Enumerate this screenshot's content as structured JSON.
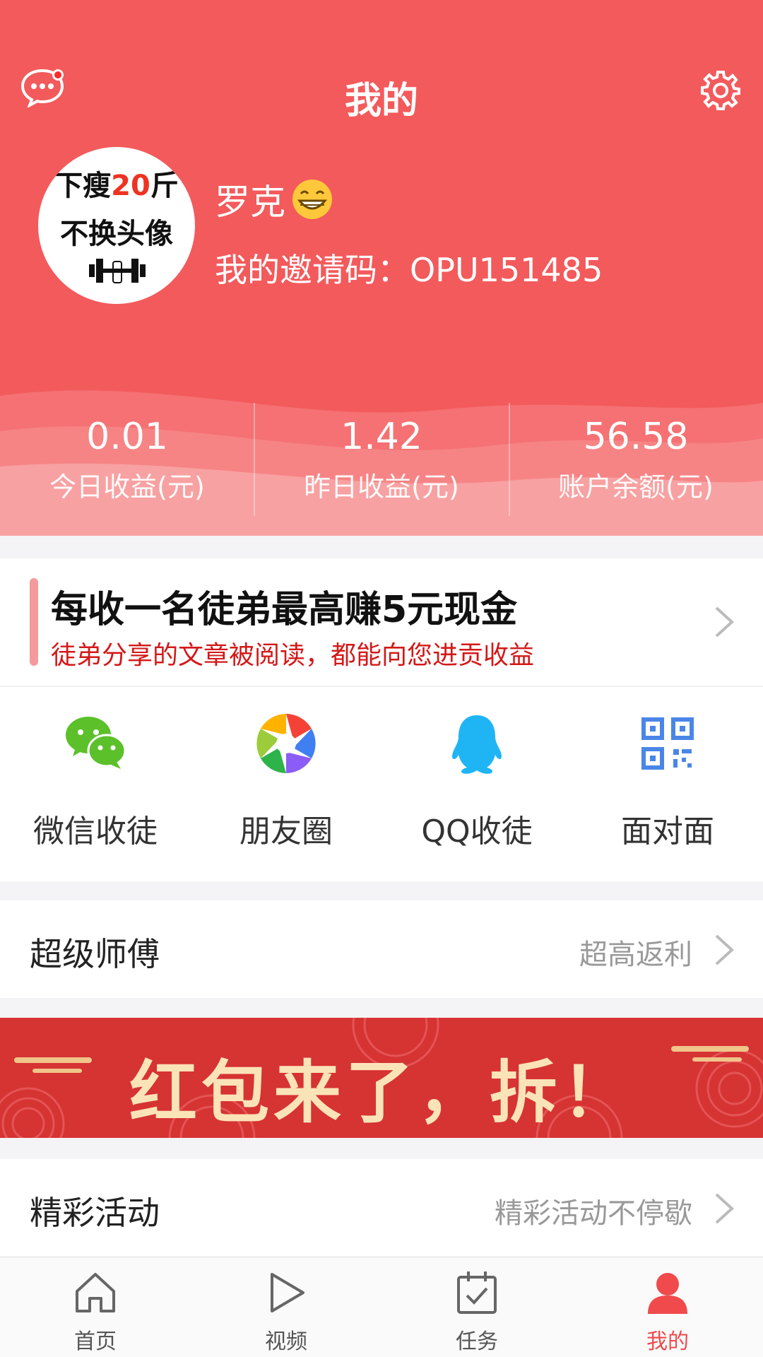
{
  "header": {
    "title": "我的",
    "username": "罗克",
    "invite_label": "我的邀请码：",
    "invite_code": "OPU151485",
    "avatar_text": {
      "line1_a": "下瘦",
      "line1_b": "20",
      "line1_c": "斤",
      "line2": "不换头像"
    }
  },
  "stats": [
    {
      "value": "0.01",
      "label": "今日收益(元)"
    },
    {
      "value": "1.42",
      "label": "昨日收益(元)"
    },
    {
      "value": "56.58",
      "label": "账户余额(元)"
    }
  ],
  "promo": {
    "headline": "每收一名徒弟最高赚5元现金",
    "subline": "徒弟分享的文章被阅读，都能向您进贡收益"
  },
  "share": [
    {
      "label": "微信收徒",
      "icon": "wechat-icon"
    },
    {
      "label": "朋友圈",
      "icon": "moments-icon"
    },
    {
      "label": "QQ收徒",
      "icon": "qq-icon"
    },
    {
      "label": "面对面",
      "icon": "qrcode-icon"
    }
  ],
  "rows": {
    "master": {
      "title": "超级师傅",
      "hint": "超高返利"
    },
    "events": {
      "title": "精彩活动",
      "hint": "精彩活动不停歇"
    }
  },
  "banner": {
    "text": "红包来了，拆！"
  },
  "tabs": [
    {
      "label": "首页",
      "icon": "home-icon"
    },
    {
      "label": "视频",
      "icon": "play-icon"
    },
    {
      "label": "任务",
      "icon": "task-icon"
    },
    {
      "label": "我的",
      "icon": "user-icon",
      "active": true
    }
  ],
  "colors": {
    "primary": "#f35a5c",
    "active_tab": "#f04a4c",
    "promo_sub": "#d41818"
  }
}
